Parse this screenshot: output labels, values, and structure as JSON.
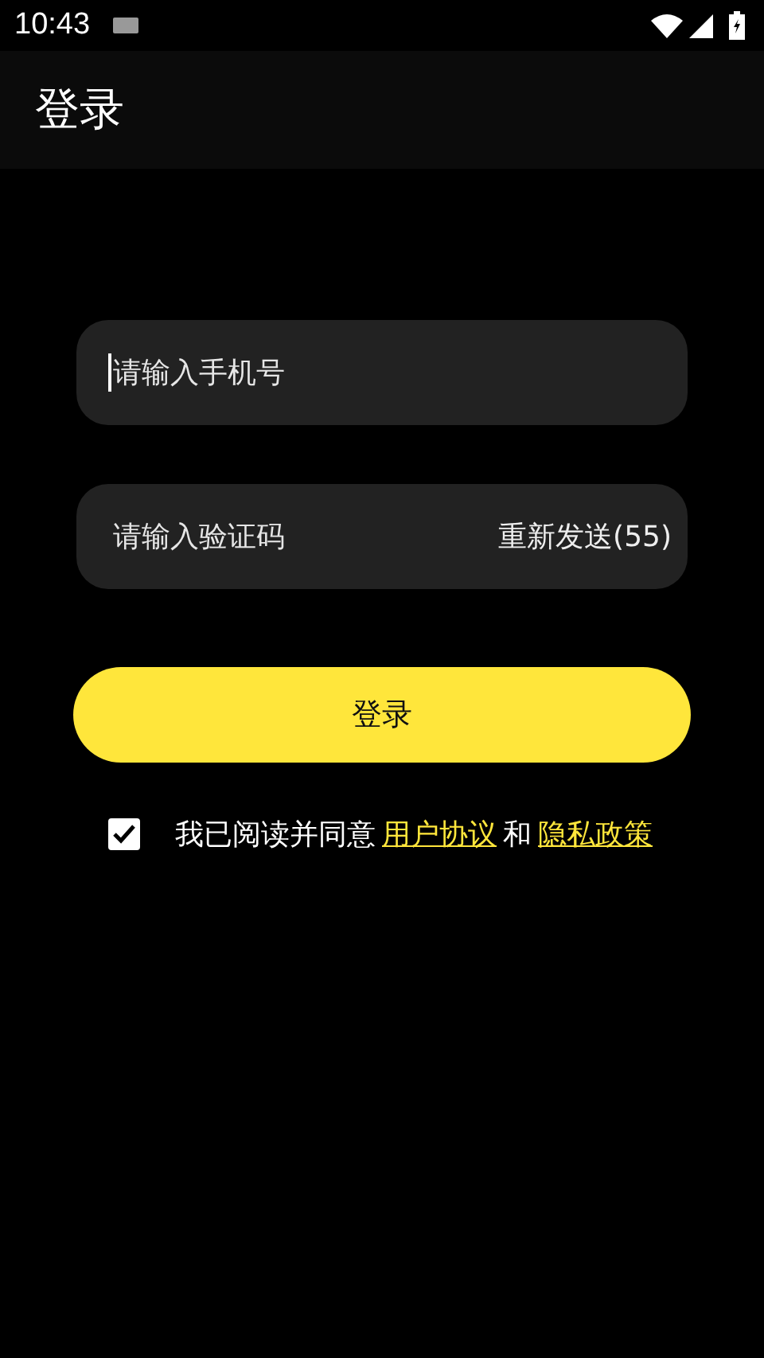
{
  "status_bar": {
    "time": "10:43"
  },
  "app_bar": {
    "title": "登录"
  },
  "phone_field": {
    "placeholder": "请输入手机号",
    "focused": true
  },
  "code_field": {
    "placeholder": "请输入验证码",
    "resend": "重新发送(55)"
  },
  "login_button": {
    "label": "登录"
  },
  "agreement": {
    "checked": true,
    "text": "我已阅读并同意",
    "link_1": "用户协议",
    "joiner": "和",
    "link_2": "隐私政策"
  }
}
